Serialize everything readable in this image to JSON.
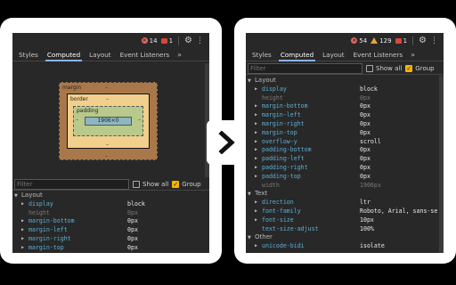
{
  "left": {
    "counts": {
      "errors": "14",
      "messages": "1"
    },
    "tabs": [
      "Styles",
      "Computed",
      "Layout",
      "Event Listeners"
    ],
    "more": "»",
    "boxmodel": {
      "margin": "margin",
      "border": "border",
      "padding": "padding",
      "content": "1906×0",
      "dash": "–"
    },
    "filter": {
      "placeholder": "Filter",
      "show_all": "Show all",
      "group": "Group"
    },
    "group": "Layout",
    "props": [
      {
        "name": "display",
        "value": "block",
        "dim": false,
        "expand": true
      },
      {
        "name": "height",
        "value": "0px",
        "dim": true,
        "expand": false
      },
      {
        "name": "margin-bottom",
        "value": "0px",
        "dim": false,
        "expand": true
      },
      {
        "name": "margin-left",
        "value": "0px",
        "dim": false,
        "expand": true
      },
      {
        "name": "margin-right",
        "value": "0px",
        "dim": false,
        "expand": true
      },
      {
        "name": "margin-top",
        "value": "0px",
        "dim": false,
        "expand": true
      }
    ]
  },
  "right": {
    "counts": {
      "errors": "54",
      "warnings": "129",
      "messages": "1"
    },
    "tabs": [
      "Styles",
      "Computed",
      "Layout",
      "Event Listeners"
    ],
    "more": "»",
    "filter": {
      "placeholder": "Filter",
      "show_all": "Show all",
      "group": "Group"
    },
    "groups": [
      {
        "label": "Layout",
        "props": [
          {
            "name": "display",
            "value": "block",
            "dim": false,
            "expand": true
          },
          {
            "name": "height",
            "value": "0px",
            "dim": true,
            "expand": false
          },
          {
            "name": "margin-bottom",
            "value": "0px",
            "dim": false,
            "expand": true
          },
          {
            "name": "margin-left",
            "value": "0px",
            "dim": false,
            "expand": true
          },
          {
            "name": "margin-right",
            "value": "0px",
            "dim": false,
            "expand": true
          },
          {
            "name": "margin-top",
            "value": "0px",
            "dim": false,
            "expand": true
          },
          {
            "name": "overflow-y",
            "value": "scroll",
            "dim": false,
            "expand": true
          },
          {
            "name": "padding-bottom",
            "value": "0px",
            "dim": false,
            "expand": true
          },
          {
            "name": "padding-left",
            "value": "0px",
            "dim": false,
            "expand": true
          },
          {
            "name": "padding-right",
            "value": "0px",
            "dim": false,
            "expand": true
          },
          {
            "name": "padding-top",
            "value": "0px",
            "dim": false,
            "expand": true
          },
          {
            "name": "width",
            "value": "1906px",
            "dim": true,
            "expand": false
          }
        ]
      },
      {
        "label": "Text",
        "props": [
          {
            "name": "direction",
            "value": "ltr",
            "dim": false,
            "expand": true
          },
          {
            "name": "font-family",
            "value": "Roboto, Arial, sans-se",
            "dim": false,
            "expand": true
          },
          {
            "name": "font-size",
            "value": "10px",
            "dim": false,
            "expand": true
          },
          {
            "name": "text-size-adjust",
            "value": "100%",
            "dim": false,
            "expand": false
          }
        ]
      },
      {
        "label": "Other",
        "props": [
          {
            "name": "unicode-bidi",
            "value": "isolate",
            "dim": false,
            "expand": true
          }
        ]
      }
    ]
  },
  "arrow_icon": "chevron-right-icon"
}
